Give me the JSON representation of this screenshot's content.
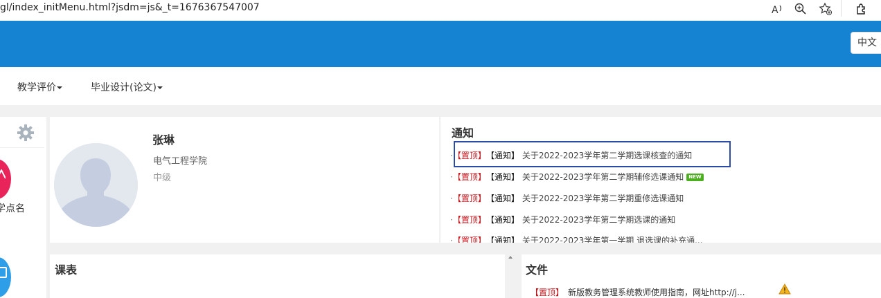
{
  "browser": {
    "url": "gl/index_initMenu.html?jsdm=js&_t=1676367547007",
    "icons": [
      "read-aloud-icon",
      "zoom-icon",
      "favorite-add-icon",
      "extensions-icon"
    ]
  },
  "header": {
    "language_button": "中文"
  },
  "nav": {
    "items": [
      {
        "label": "教学评价"
      },
      {
        "label": "毕业设计(论文)"
      }
    ]
  },
  "sidebar": {
    "item_label": "学点名",
    "icons": [
      "gear-icon",
      "roll-call-icon",
      "document-icon"
    ]
  },
  "profile": {
    "name": "张琳",
    "college": "电气工程学院",
    "rank": "中级"
  },
  "notices": {
    "title": "通知",
    "items": [
      {
        "pin": "【置顶】",
        "tag": "【通知】",
        "text": "关于2022-2023学年第二学期选课核查的通知",
        "highlighted": true
      },
      {
        "pin": "【置顶】",
        "tag": "【通知】",
        "text": "关于2022-2023学年第二学期辅修选课通知",
        "badge": "NEW"
      },
      {
        "pin": "【置顶】",
        "tag": "【通知】",
        "text": "关于2022-2023学年第二学期重修选课通知"
      },
      {
        "pin": "【置顶】",
        "tag": "【通知】",
        "text": "关于2022-2023学年第二学期选课的通知"
      },
      {
        "pin": "【置顶】",
        "tag": "【通知】",
        "text": "关于2022-2023学年第一学期 退选课的补充通..."
      }
    ]
  },
  "schedule": {
    "title": "课表"
  },
  "files": {
    "title": "文件",
    "items": [
      {
        "pin": "【置顶】",
        "text": "新版教务管理系统教师使用指南，网址http://j..."
      }
    ]
  },
  "colors": {
    "header_blue": "#1683d2",
    "pin_red": "#c4161c",
    "highlight_border": "#2c4aa8",
    "new_badge": "#4caf1f"
  }
}
